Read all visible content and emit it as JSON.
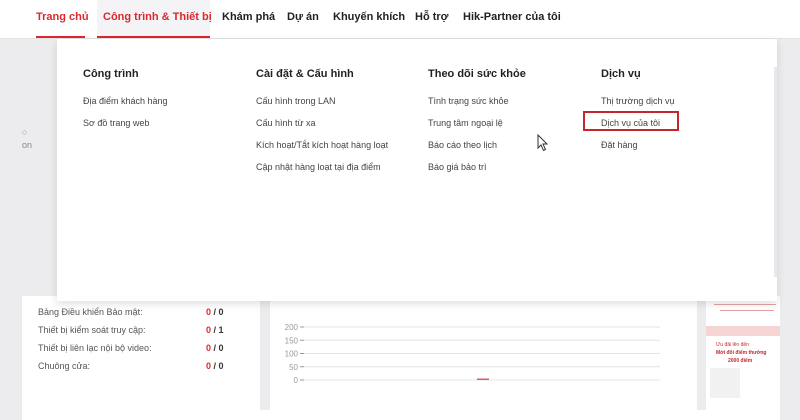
{
  "nav": {
    "items": [
      {
        "label": "Trang chủ"
      },
      {
        "label": "Công trình & Thiết bị"
      },
      {
        "label": "Khám phá"
      },
      {
        "label": "Dự án"
      },
      {
        "label": "Khuyến khích"
      },
      {
        "label": "Hỗ trợ"
      },
      {
        "label": "Hik-Partner của tôi"
      }
    ]
  },
  "menu": {
    "columns": [
      {
        "title": "Công trình",
        "links": [
          "Địa điểm khách hàng",
          "Sơ đồ trang web"
        ]
      },
      {
        "title": "Cài đặt & Cấu hình",
        "links": [
          "Cấu hình trong LAN",
          "Cấu hình từ xa",
          "Kích hoạt/Tắt kích hoạt hàng loạt",
          "Cập nhật hàng loạt tại địa điểm"
        ]
      },
      {
        "title": "Theo dõi sức khỏe",
        "links": [
          "Tình trạng sức khỏe",
          "Trung tâm ngoại lệ",
          "Báo cáo theo lịch",
          "Báo giá bảo trì"
        ]
      },
      {
        "title": "Dịch vụ",
        "links": [
          "Thị trường dịch vụ",
          "Dịch vụ của tôi",
          "Đặt hàng"
        ]
      }
    ]
  },
  "stats": [
    {
      "label": "Bảng Điều khiển Bảo mật:",
      "a": "0",
      "sep": " / ",
      "b": "0"
    },
    {
      "label": "Thiết bị kiểm soát truy cập:",
      "a": "0",
      "sep": " / ",
      "b": "1"
    },
    {
      "label": "Thiết bị liên lạc nội bộ video:",
      "a": "0",
      "sep": " / ",
      "b": "0"
    },
    {
      "label": "Chuông cửa:",
      "a": "0",
      "sep": " / ",
      "b": "0"
    }
  ],
  "chart_data": {
    "type": "bar",
    "categories": [
      ""
    ],
    "values": [
      1
    ],
    "ylim": [
      0,
      200
    ],
    "yticks": [
      "200",
      "150",
      "100",
      "50",
      "0"
    ],
    "grid": true,
    "bar_color": "#e05a5f"
  },
  "background": {
    "edge_text": "on"
  },
  "ad": {
    "line1": "Ưu đãi lên đến",
    "line2": "Mời đổi điểm thưởng",
    "line3": "2000 điểm"
  },
  "colors": {
    "accent": "#d9282f",
    "highlight_border": "#c4262d"
  }
}
